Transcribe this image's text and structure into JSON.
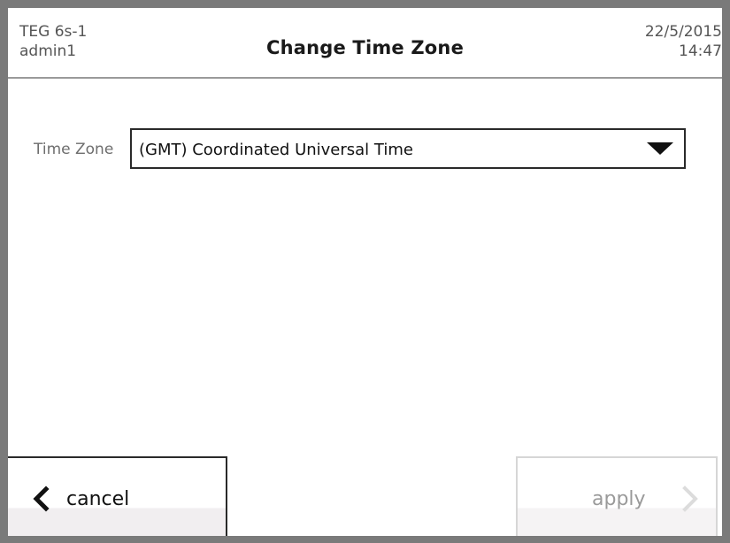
{
  "header": {
    "device_name": "TEG 6s-1",
    "user": "admin1",
    "title": "Change Time Zone",
    "date": "22/5/2015",
    "time": "14:47"
  },
  "form": {
    "time_zone_label": "Time Zone",
    "time_zone_value": "(GMT) Coordinated Universal Time"
  },
  "buttons": {
    "cancel_label": "cancel",
    "apply_label": "apply"
  },
  "icons": {
    "cancel": "chevron-left-icon",
    "apply": "chevron-right-icon",
    "dropdown": "caret-down-icon"
  },
  "colors": {
    "bezel": "#7a7a7a",
    "apply_disabled": "#9a9a9a"
  }
}
